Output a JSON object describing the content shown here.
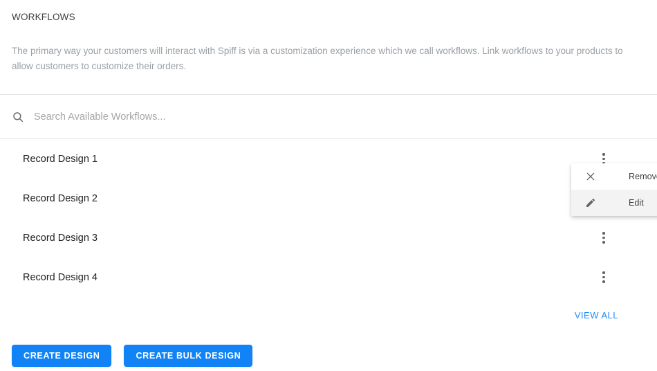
{
  "section": {
    "title": "WORKFLOWS",
    "description": "The primary way your customers will interact with Spiff is via a customization experience which we call workflows. Link workflows to your products to allow customers to customize their orders."
  },
  "search": {
    "placeholder": "Search Available Workflows...",
    "value": "",
    "icon": "search-icon"
  },
  "list": {
    "rows": [
      {
        "label": "Record Design 1",
        "menu_icon": "more-vertical-icon"
      },
      {
        "label": "Record Design 2",
        "menu_icon": "more-vertical-icon"
      },
      {
        "label": "Record Design 3",
        "menu_icon": "more-vertical-icon"
      },
      {
        "label": "Record Design 4",
        "menu_icon": "more-vertical-icon"
      }
    ],
    "view_all_label": "VIEW ALL"
  },
  "context_menu": {
    "open": true,
    "anchored_to_row": "Record Design 2",
    "items": [
      {
        "label": "Remove",
        "icon": "close-x-icon",
        "hovered": false
      },
      {
        "label": "Edit",
        "icon": "pencil-icon",
        "hovered": true
      }
    ]
  },
  "footer": {
    "buttons": [
      {
        "label": "CREATE DESIGN"
      },
      {
        "label": "CREATE BULK DESIGN"
      }
    ]
  },
  "colors": {
    "accent_blue": "#1283f6",
    "link_blue": "#1a8cff",
    "text_primary": "#212121",
    "text_muted": "#9aa0a6",
    "divider": "#e5e5e5",
    "menu_hover": "#f3f3f3"
  }
}
